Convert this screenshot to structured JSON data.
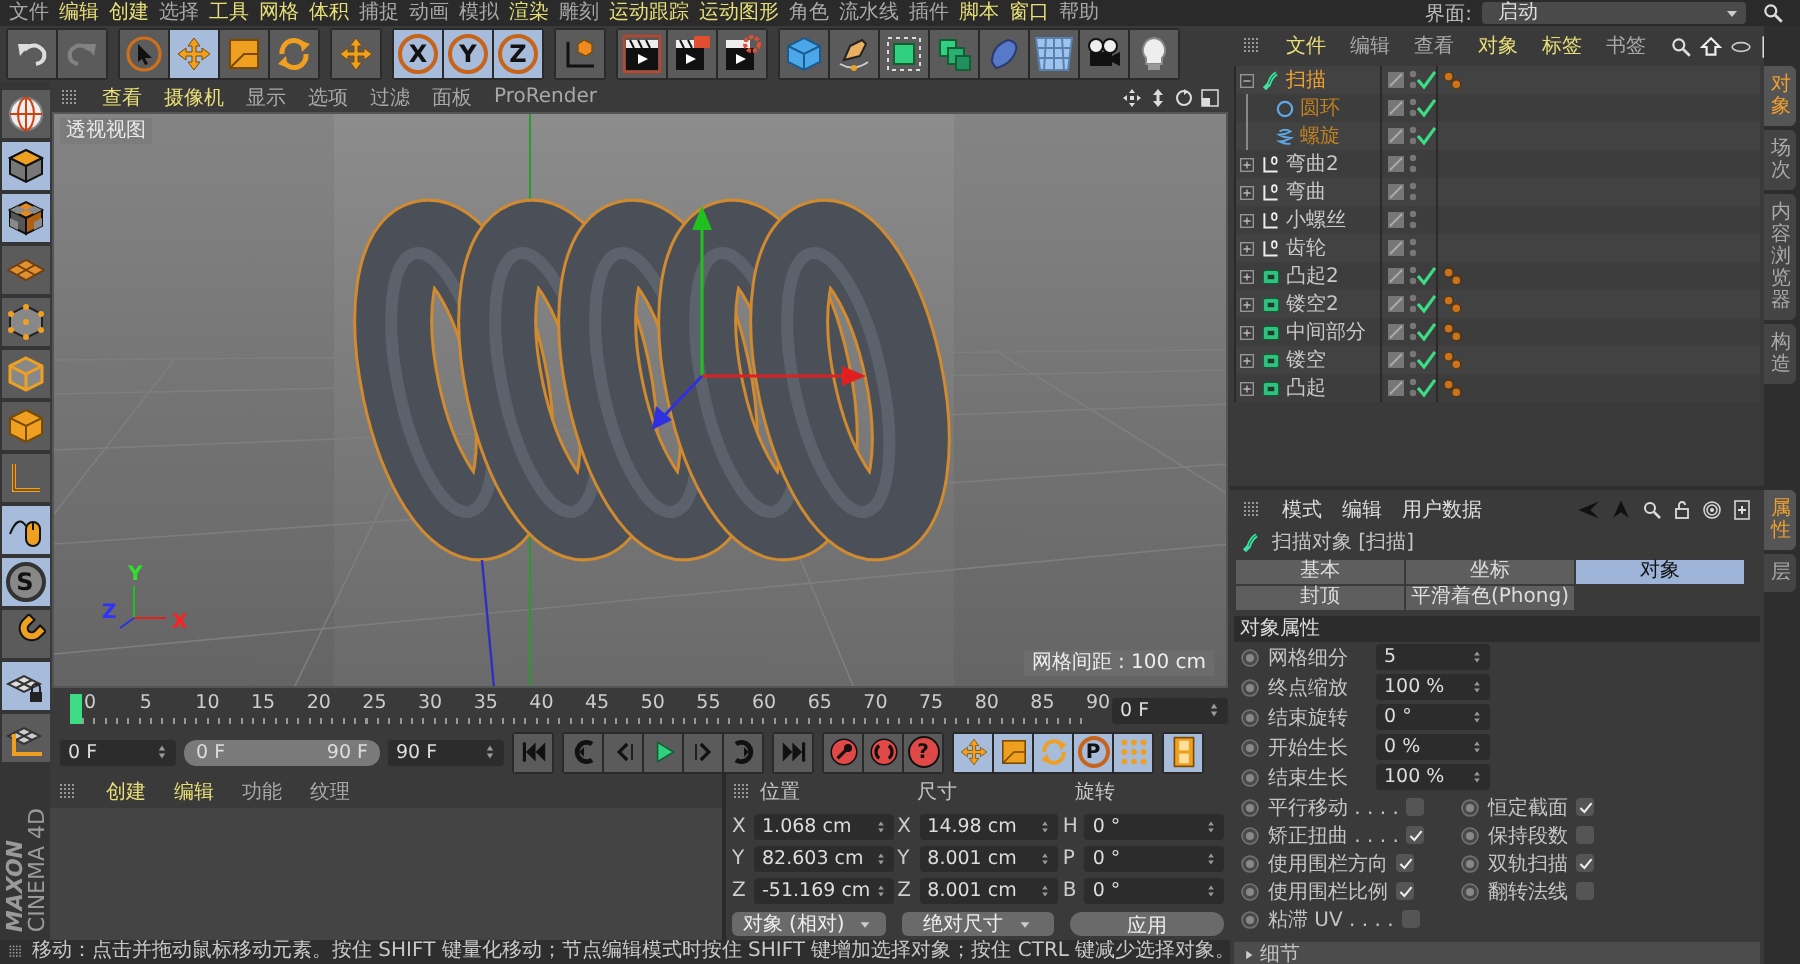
{
  "menu_bar": {
    "items": [
      {
        "label": "文件",
        "highlighted": false
      },
      {
        "label": "编辑",
        "highlighted": true
      },
      {
        "label": "创建",
        "highlighted": true
      },
      {
        "label": "选择",
        "highlighted": false
      },
      {
        "label": "工具",
        "highlighted": true
      },
      {
        "label": "网格",
        "highlighted": true
      },
      {
        "label": "体积",
        "highlighted": true
      },
      {
        "label": "捕捉",
        "highlighted": false
      },
      {
        "label": "动画",
        "highlighted": false
      },
      {
        "label": "模拟",
        "highlighted": false
      },
      {
        "label": "渲染",
        "highlighted": true
      },
      {
        "label": "雕刻",
        "highlighted": false
      },
      {
        "label": "运动跟踪",
        "highlighted": true
      },
      {
        "label": "运动图形",
        "highlighted": true
      },
      {
        "label": "角色",
        "highlighted": false
      },
      {
        "label": "流水线",
        "highlighted": false
      },
      {
        "label": "插件",
        "highlighted": false
      },
      {
        "label": "脚本",
        "highlighted": true
      },
      {
        "label": "窗口",
        "highlighted": true
      },
      {
        "label": "帮助",
        "highlighted": false
      }
    ],
    "layout": {
      "label": "界面:",
      "value": "启动"
    }
  },
  "toolbar": {
    "groups": [
      {
        "items": [
          {
            "kind": "undo",
            "active": false,
            "disabled": false
          },
          {
            "kind": "redo",
            "active": false,
            "disabled": true
          }
        ]
      },
      {
        "items": [
          {
            "kind": "select",
            "active": false,
            "disabled": false
          },
          {
            "kind": "move",
            "active": true,
            "disabled": false
          },
          {
            "kind": "scale",
            "active": false,
            "disabled": false
          },
          {
            "kind": "rotate",
            "active": false,
            "disabled": false
          }
        ]
      },
      {
        "items": [
          {
            "kind": "move",
            "active": false,
            "disabled": false
          }
        ]
      },
      {
        "items": [
          {
            "kind": "axis",
            "label": "X",
            "active": true,
            "disabled": false
          },
          {
            "kind": "axis",
            "label": "Y",
            "active": true,
            "disabled": false
          },
          {
            "kind": "axis",
            "label": "Z",
            "active": true,
            "disabled": false
          }
        ]
      },
      {
        "items": [
          {
            "kind": "coords",
            "active": false,
            "disabled": false
          }
        ]
      },
      {
        "items": [
          {
            "kind": "render-view",
            "active": false,
            "disabled": false
          },
          {
            "kind": "render-picture",
            "active": false,
            "disabled": false
          },
          {
            "kind": "render-settings",
            "active": false,
            "disabled": false
          }
        ]
      },
      {
        "items": [
          {
            "kind": "cube",
            "active": false,
            "disabled": false
          },
          {
            "kind": "pen",
            "active": false,
            "disabled": false
          },
          {
            "kind": "subdiv",
            "active": false,
            "disabled": false
          },
          {
            "kind": "array",
            "active": false,
            "disabled": false
          },
          {
            "kind": "deformer",
            "active": false,
            "disabled": false
          },
          {
            "kind": "floor",
            "active": false,
            "disabled": false
          },
          {
            "kind": "camera",
            "active": false,
            "disabled": false
          },
          {
            "kind": "light",
            "active": false,
            "disabled": false
          }
        ]
      }
    ]
  },
  "left_toolbar": {
    "items": [
      {
        "kind": "globe",
        "active": false
      },
      {
        "kind": "model",
        "active": true
      },
      {
        "kind": "texture",
        "active": true
      },
      {
        "kind": "workplane",
        "active": false
      },
      {
        "kind": "points",
        "active": false
      },
      {
        "kind": "edges",
        "active": false
      },
      {
        "kind": "polygons",
        "active": false
      },
      {
        "kind": "axis-mode",
        "active": false
      },
      {
        "kind": "tweak",
        "active": true
      },
      {
        "kind": "snap",
        "label": "S",
        "active": true
      },
      {
        "kind": "magnet",
        "active": false
      },
      {
        "kind": "lock-workplane",
        "active": true
      },
      {
        "kind": "planar",
        "active": false
      }
    ],
    "logo": [
      "MAXON",
      "CINEMA 4D"
    ]
  },
  "viewport": {
    "menu": [
      {
        "label": "查看",
        "highlighted": true
      },
      {
        "label": "摄像机",
        "highlighted": true
      },
      {
        "label": "显示",
        "highlighted": false
      },
      {
        "label": "选项",
        "highlighted": false
      },
      {
        "label": "过滤",
        "highlighted": false
      },
      {
        "label": "面板",
        "highlighted": false
      },
      {
        "label": "ProRender",
        "highlighted": false
      }
    ],
    "view_name": "透视视图",
    "grid_spacing": "网格间距 : 100 cm",
    "axis_labels": [
      "Y",
      "Z",
      "X"
    ]
  },
  "timeline": {
    "ticks": [
      "0",
      "5",
      "10",
      "15",
      "20",
      "25",
      "30",
      "35",
      "40",
      "45",
      "50",
      "55",
      "60",
      "65",
      "70",
      "75",
      "80",
      "85",
      "90"
    ],
    "playhead": {
      "level": 0
    },
    "current_frame": "0 F"
  },
  "transport": {
    "start_frame": "0 F",
    "range": {
      "start": "0 F",
      "end": "90 F",
      "level": 1
    },
    "end_frame": "90 F",
    "groups": [
      {
        "items": [
          {
            "kind": "first-frame",
            "active": false
          }
        ]
      },
      {
        "items": [
          {
            "kind": "prev-key",
            "active": false
          },
          {
            "kind": "prev-frame",
            "active": false
          },
          {
            "kind": "play",
            "active": false
          },
          {
            "kind": "next-frame",
            "active": false
          },
          {
            "kind": "next-key",
            "active": false
          }
        ]
      },
      {
        "items": [
          {
            "kind": "last-frame",
            "active": false
          }
        ]
      },
      {
        "items": [
          {
            "kind": "record",
            "active": false
          },
          {
            "kind": "autokey",
            "active": false
          },
          {
            "kind": "help-key",
            "label": "?",
            "active": false
          }
        ]
      },
      {
        "items": [
          {
            "kind": "move",
            "active": true
          },
          {
            "kind": "scale",
            "active": true
          },
          {
            "kind": "rotate",
            "active": true
          },
          {
            "kind": "param",
            "label": "P",
            "active": true
          },
          {
            "kind": "points-grid",
            "active": true
          }
        ]
      },
      {
        "items": [
          {
            "kind": "filmstrip",
            "active": true
          }
        ]
      }
    ]
  },
  "materials": {
    "menu": [
      {
        "label": "创建",
        "highlighted": true
      },
      {
        "label": "编辑",
        "highlighted": true
      },
      {
        "label": "功能",
        "highlighted": false
      },
      {
        "label": "纹理",
        "highlighted": false
      }
    ]
  },
  "coordinates": {
    "headers": [
      "位置",
      "尺寸",
      "旋转"
    ],
    "rows": [
      {
        "position_axis": "X",
        "position": "1.068 cm",
        "size_axis": "X",
        "size": "14.98 cm",
        "rotation_axis": "H",
        "rotation": "0 °"
      },
      {
        "position_axis": "Y",
        "position": "82.603 cm",
        "size_axis": "Y",
        "size": "8.001 cm",
        "rotation_axis": "P",
        "rotation": "0 °"
      },
      {
        "position_axis": "Z",
        "position": "-51.169 cm",
        "size_axis": "Z",
        "size": "8.001 cm",
        "rotation_axis": "B",
        "rotation": "0 °"
      }
    ],
    "position_mode": "对象 (相对)",
    "size_mode": "绝对尺寸",
    "apply": "应用"
  },
  "status_bar": "移动：点击并拖动鼠标移动元素。按住 SHIFT 键量化移动；节点编辑模式时按住 SHIFT 键增加选择对象；按住 CTRL 键减少选择对象。",
  "objects": {
    "menu": [
      {
        "label": "文件",
        "highlighted": true
      },
      {
        "label": "编辑",
        "highlighted": false
      },
      {
        "label": "查看",
        "highlighted": false
      },
      {
        "label": "对象",
        "highlighted": true
      },
      {
        "label": "标签",
        "highlighted": true
      },
      {
        "label": "书签",
        "highlighted": false
      }
    ],
    "tree": [
      {
        "name": "扫描",
        "kind": "sweep",
        "selected": true,
        "enabled": true,
        "tagged": true,
        "expanded": true,
        "children": [
          {
            "name": "圆环",
            "kind": "circle",
            "selected": true,
            "enabled": true,
            "tagged": false
          },
          {
            "name": "螺旋",
            "kind": "helix",
            "selected": true,
            "enabled": true,
            "tagged": false
          }
        ]
      },
      {
        "name": "弯曲2",
        "kind": "bend",
        "selected": false,
        "enabled": false,
        "tagged": false,
        "expanded": false
      },
      {
        "name": "弯曲",
        "kind": "bend",
        "selected": false,
        "enabled": false,
        "tagged": false,
        "expanded": false
      },
      {
        "name": "小螺丝",
        "kind": "bend",
        "selected": false,
        "enabled": false,
        "tagged": false,
        "expanded": false
      },
      {
        "name": "齿轮",
        "kind": "bend",
        "selected": false,
        "enabled": false,
        "tagged": false,
        "expanded": false
      },
      {
        "name": "凸起2",
        "kind": "boole",
        "selected": false,
        "enabled": true,
        "tagged": true,
        "expanded": false
      },
      {
        "name": "镂空2",
        "kind": "boole",
        "selected": false,
        "enabled": true,
        "tagged": true,
        "expanded": false
      },
      {
        "name": "中间部分",
        "kind": "boole",
        "selected": false,
        "enabled": true,
        "tagged": true,
        "expanded": false
      },
      {
        "name": "镂空",
        "kind": "boole",
        "selected": false,
        "enabled": true,
        "tagged": true,
        "expanded": false
      },
      {
        "name": "凸起",
        "kind": "boole",
        "selected": false,
        "enabled": true,
        "tagged": true,
        "expanded": false
      }
    ]
  },
  "attributes": {
    "menu": [
      "模式",
      "编辑",
      "用户数据"
    ],
    "title": "扫描对象 [扫描]",
    "tabs": [
      {
        "label": "基本",
        "selected": false
      },
      {
        "label": "坐标",
        "selected": false
      },
      {
        "label": "对象",
        "selected": true
      },
      {
        "label": "封顶",
        "selected": false
      },
      {
        "label": "平滑着色(Phong)",
        "selected": false
      }
    ],
    "section": "对象属性",
    "fields": [
      {
        "label": "网格细分",
        "value": "5"
      },
      {
        "label": "终点缩放",
        "value": "100 %"
      },
      {
        "label": "结束旋转",
        "value": "0 °"
      },
      {
        "label": "开始生长",
        "value": "0 %"
      },
      {
        "label": "结束生长",
        "value": "100 %"
      }
    ],
    "options": [
      {
        "label": "平行移动 . . . .",
        "checked": false
      },
      {
        "label": "恒定截面",
        "checked": true
      },
      {
        "label": "矫正扭曲 . . . .",
        "checked": true
      },
      {
        "label": "保持段数",
        "checked": false
      },
      {
        "label": "使用围栏方向",
        "checked": true
      },
      {
        "label": "双轨扫描",
        "checked": true
      },
      {
        "label": "使用围栏比例",
        "checked": true
      },
      {
        "label": "翻转法线",
        "checked": false
      },
      {
        "label": "粘滞 UV . . . .",
        "checked": false
      }
    ],
    "details": {
      "label": "细节",
      "expanded": false
    }
  },
  "side_tabs": {
    "top": [
      {
        "label": "对象",
        "selected": true
      },
      {
        "label": "场次",
        "selected": false
      },
      {
        "label": "内容浏览器",
        "selected": false
      },
      {
        "label": "构造",
        "selected": false
      }
    ],
    "bottom": [
      {
        "label": "属性",
        "selected": true
      },
      {
        "label": "层",
        "selected": false
      }
    ]
  }
}
